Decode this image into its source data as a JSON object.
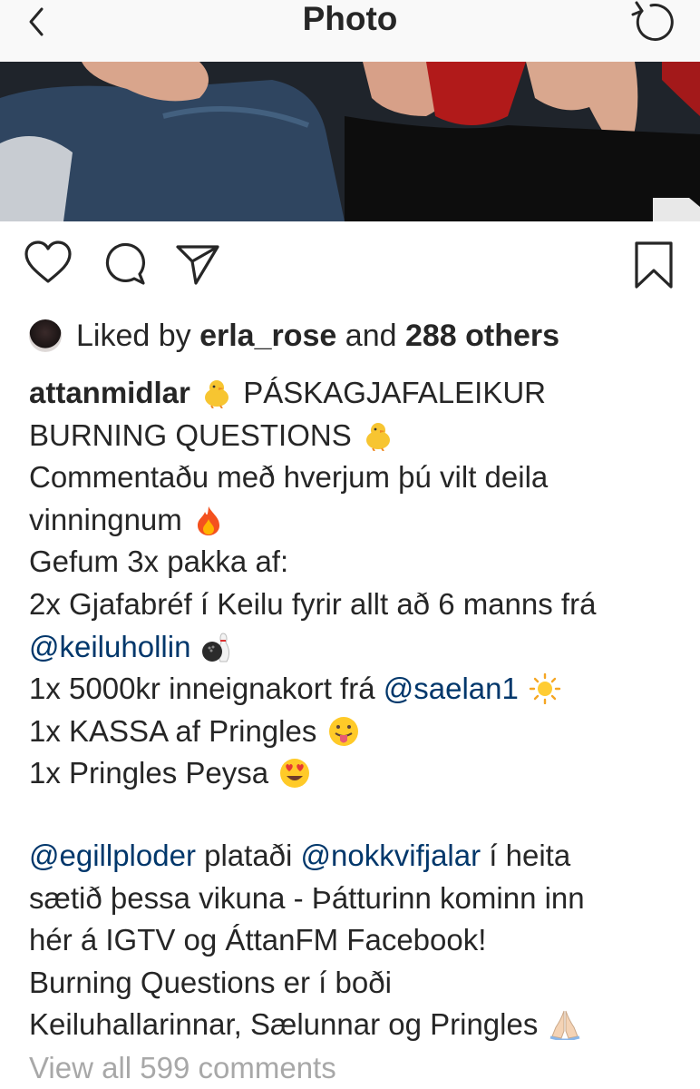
{
  "header": {
    "title": "Photo"
  },
  "likes": {
    "prefix": "Liked by",
    "user": "erla_rose",
    "middle": "and",
    "others": "288 others"
  },
  "caption": {
    "username": "attanmidlar",
    "l1_text": "PÁSKAGJAFALEIKUR",
    "l2_text": "BURNING QUESTIONS",
    "l3": "Commentaðu með hverjum þú vilt deila",
    "l4": "vinningnum",
    "l5": "Gefum 3x pakka af:",
    "l6": "2x Gjafabréf í Keilu fyrir allt að 6 manns frá",
    "l7_mention": "@keiluhollin",
    "l8_text": "1x 5000kr inneignakort frá",
    "l8_mention": "@saelan1",
    "l9": "1x KASSA af Pringles",
    "l10": "1x Pringles Peysa",
    "l11_mention1": "@egillploder",
    "l11_text1": "plataði",
    "l11_mention2": "@nokkvifjalar",
    "l11_text2": "í heita",
    "l12": "sætið þessa vikuna - Þátturinn kominn inn",
    "l13": "hér á IGTV og ÁttanFM Facebook!",
    "l14": "Burning Questions er í boði",
    "l15": "Keiluhallarinnar, Sælunnar og Pringles"
  },
  "comments": {
    "view_all": "View all 599 comments"
  },
  "icons": {
    "back": "chevron-left-icon",
    "refresh": "refresh-icon",
    "like": "heart-icon",
    "comment": "comment-icon",
    "share": "paper-plane-icon",
    "save": "bookmark-icon",
    "chick": "chick-emoji",
    "fire": "fire-emoji",
    "bowling": "bowling-emoji",
    "sun": "sun-emoji",
    "tongue": "tongue-emoji",
    "heart_eyes": "heart-eyes-emoji",
    "pray": "pray-emoji"
  },
  "colors": {
    "mention": "#00376b",
    "text": "#262626",
    "muted": "#a8a8a8",
    "header_bg": "#f9f9f9"
  }
}
